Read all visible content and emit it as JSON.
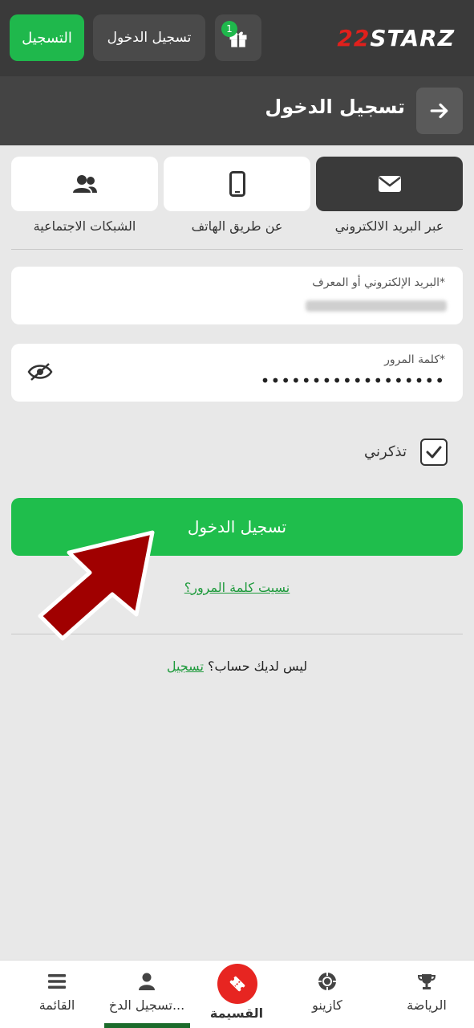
{
  "header": {
    "register_label": "التسجيل",
    "login_label": "تسجيل الدخول",
    "gift_badge": "1",
    "logo_prefix": "22",
    "logo_text": "STARZ"
  },
  "titlebar": {
    "title": "تسجيل الدخول"
  },
  "methods": [
    {
      "label": "عبر البريد الالكتروني",
      "icon": "envelope-icon",
      "active": true
    },
    {
      "label": "عن طريق الهاتف",
      "icon": "phone-icon",
      "active": false
    },
    {
      "label": "الشبكات الاجتماعية",
      "icon": "users-icon",
      "active": false
    }
  ],
  "form": {
    "email_label": "البريد الإلكتروني أو المعرف*",
    "password_label": "كلمة المرور*",
    "password_value": "••••••••••••••••••",
    "remember_label": "تذكرني",
    "remember_checked": true,
    "submit_label": "تسجيل الدخول",
    "forgot_label": "نسيت كلمة المرور؟",
    "no_account_text": "ليس لديك حساب؟",
    "register_link": "تسجيل"
  },
  "bottom_nav": [
    {
      "label": "الرياضة",
      "icon": "trophy-icon"
    },
    {
      "label": "كازينو",
      "icon": "chip-icon"
    },
    {
      "label": "القسيمة",
      "icon": "ticket-icon"
    },
    {
      "label": "تسجيل الدخ...",
      "icon": "user-icon"
    },
    {
      "label": "القائمة",
      "icon": "menu-icon"
    }
  ],
  "colors": {
    "accent": "#1fbe4c",
    "header_bg": "#3a3a3a",
    "coupon": "#e72521",
    "arrow": "#a00000"
  }
}
